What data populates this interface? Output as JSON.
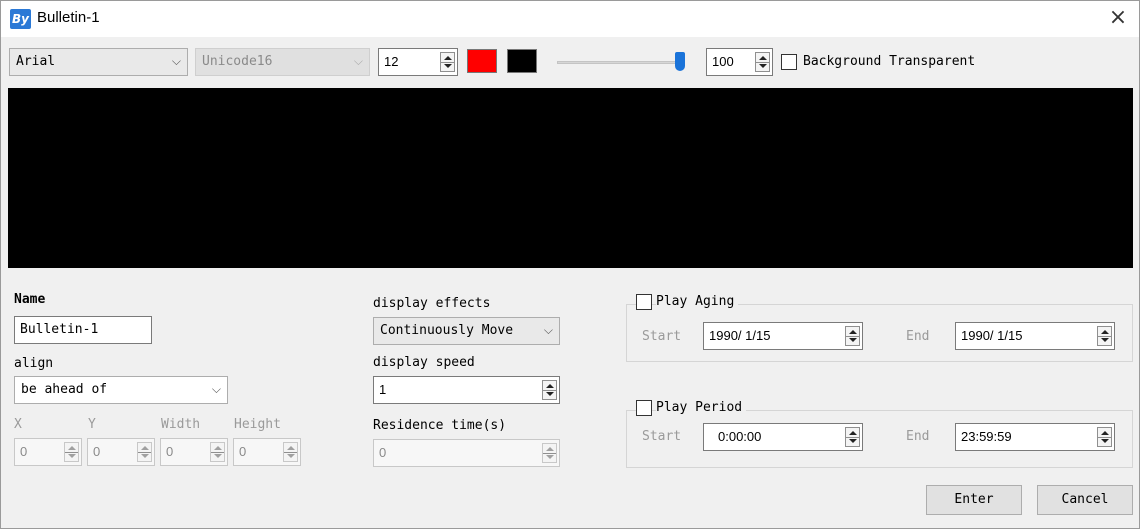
{
  "window": {
    "icon": "app-logo-icon",
    "icon_text": "By",
    "title": "Bulletin-1",
    "close": "×"
  },
  "toolbar": {
    "font": "Arial",
    "encoding": "Unicode16",
    "font_size": "12",
    "text_color": "#ff0000",
    "background_color": "#000000",
    "slider_level": 1.0,
    "opacity": "100",
    "background_transparent_label": "Background Transparent",
    "background_transparent_checked": false
  },
  "form": {
    "name_label": "Name",
    "name_value": "Bulletin-1",
    "align_label": "align",
    "align_value": "be ahead of",
    "x_label": "X",
    "x_value": "0",
    "y_label": "Y",
    "y_value": "0",
    "width_label": "Width",
    "width_value": "0",
    "height_label": "Height",
    "height_value": "0",
    "effects_label": "display effects",
    "effects_value": "Continuously Move",
    "speed_label": "display speed",
    "speed_value": "1",
    "residence_label": "Residence time(s)",
    "residence_value": "0"
  },
  "aging": {
    "label": "Play Aging",
    "checked": false,
    "start_label": "Start",
    "start_value": "1990/ 1/15",
    "end_label": "End",
    "end_value": "1990/ 1/15"
  },
  "period": {
    "label": "Play Period",
    "checked": false,
    "start_label": "Start",
    "start_value": "0:00:00",
    "end_label": "End",
    "end_value": "23:59:59"
  },
  "buttons": {
    "enter": "Enter",
    "cancel": "Cancel"
  },
  "chevron": "﹀"
}
